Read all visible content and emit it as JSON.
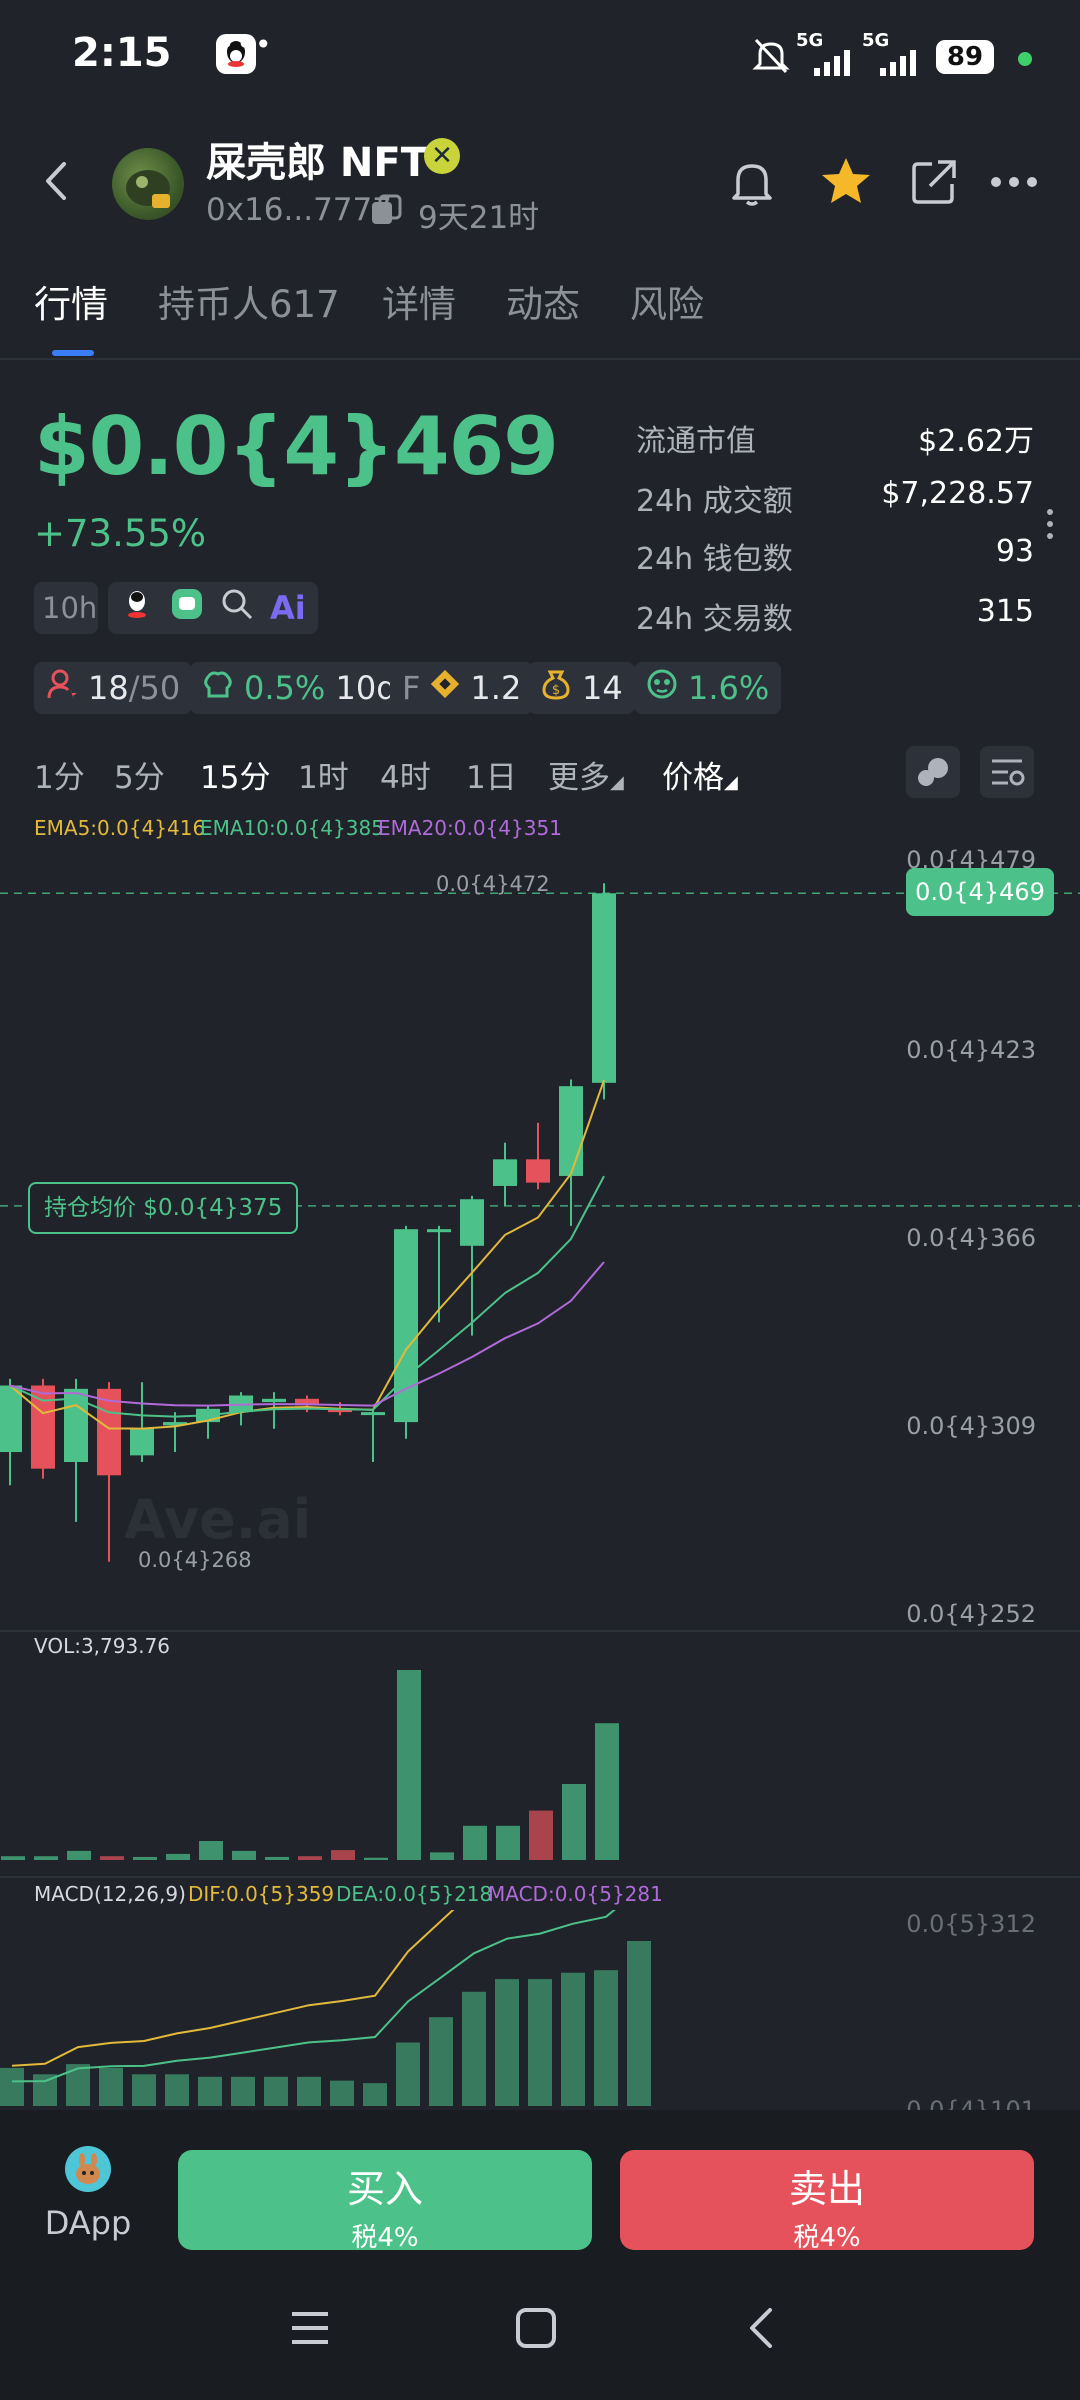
{
  "status_bar": {
    "time": "2:15",
    "dots": "•••",
    "battery": "89",
    "net1": "5G",
    "net2": "5G"
  },
  "header": {
    "token_name": "屎壳郎 NFT",
    "address": "0x16...7777",
    "age": "9天21时"
  },
  "tabs": [
    {
      "label": "行情"
    },
    {
      "label": "持币人617"
    },
    {
      "label": "详情"
    },
    {
      "label": "动态"
    },
    {
      "label": "风险"
    }
  ],
  "price": {
    "value": "$0.0{4}469",
    "change": "+73.55%"
  },
  "stats": [
    {
      "label": "流通市值",
      "value": "$2.62万"
    },
    {
      "label": "24h 成交额",
      "value": "$7,228.57"
    },
    {
      "label": "24h 钱包数",
      "value": "93"
    },
    {
      "label": "24h 交易数",
      "value": "315"
    }
  ],
  "chips1": {
    "time": "10h"
  },
  "chips2": {
    "holders": "18",
    "holders_total": "/50",
    "chef_pct": "0.5%",
    "chef_days": "10d",
    "f_label": "F",
    "f_val": "1.2",
    "bag_val": "14",
    "face_pct": "1.6%"
  },
  "intervals": {
    "items": [
      "1分",
      "5分",
      "15分",
      "1时",
      "4时",
      "1日"
    ],
    "more": "更多",
    "price": "价格",
    "active": "15分"
  },
  "ema": {
    "ema5": "EMA5:0.0{4}416",
    "ema10": "EMA10:0.0{4}385",
    "ema20": "EMA20:0.0{4}351"
  },
  "chart_data": {
    "type": "candlestick",
    "y_axis_labels": [
      "0.0{4}479",
      "0.0{4}423",
      "0.0{4}366",
      "0.0{4}309",
      "0.0{4}252"
    ],
    "current_price_label": "0.0{4}469",
    "high_label": "0.0{4}472",
    "low_label": "0.0{4}268",
    "avg_cost_label": "持仓均价 $0.0{4}375",
    "watermark": "Ave.ai",
    "candles": [
      {
        "o": 301,
        "c": 321,
        "h": 323,
        "l": 291
      },
      {
        "o": 321,
        "c": 296,
        "h": 323,
        "l": 293
      },
      {
        "o": 298,
        "c": 320,
        "h": 323,
        "l": 280
      },
      {
        "o": 320,
        "c": 294,
        "h": 322,
        "l": 268
      },
      {
        "o": 300,
        "c": 308,
        "h": 322,
        "l": 298
      },
      {
        "o": 309,
        "c": 310,
        "h": 313,
        "l": 301
      },
      {
        "o": 310,
        "c": 314,
        "h": 315,
        "l": 305
      },
      {
        "o": 313,
        "c": 318,
        "h": 319,
        "l": 309
      },
      {
        "o": 316,
        "c": 317,
        "h": 319,
        "l": 308
      },
      {
        "o": 317,
        "c": 315,
        "h": 318,
        "l": 313
      },
      {
        "o": 314,
        "c": 313,
        "h": 316,
        "l": 312
      },
      {
        "o": 313,
        "c": 313,
        "h": 314,
        "l": 298
      },
      {
        "o": 310,
        "c": 368,
        "h": 369,
        "l": 305
      },
      {
        "o": 368,
        "c": 368,
        "h": 369,
        "l": 340
      },
      {
        "o": 363,
        "c": 377,
        "h": 378,
        "l": 336
      },
      {
        "o": 381,
        "c": 389,
        "h": 394,
        "l": 375
      },
      {
        "o": 389,
        "c": 382,
        "h": 400,
        "l": 380
      },
      {
        "o": 384,
        "c": 411,
        "h": 413,
        "l": 369
      },
      {
        "o": 412,
        "c": 469,
        "h": 472,
        "l": 407
      }
    ]
  },
  "volume": {
    "label": "VOL:3,793.76",
    "bars": [
      {
        "v": 0.5,
        "up": true
      },
      {
        "v": 0.5,
        "up": true
      },
      {
        "v": 1.2,
        "up": true
      },
      {
        "v": 0.5,
        "up": false
      },
      {
        "v": 0.4,
        "up": true
      },
      {
        "v": 0.8,
        "up": true
      },
      {
        "v": 2.5,
        "up": true
      },
      {
        "v": 1.2,
        "up": true
      },
      {
        "v": 0.4,
        "up": true
      },
      {
        "v": 0.5,
        "up": false
      },
      {
        "v": 1.3,
        "up": false
      },
      {
        "v": 0.3,
        "up": true
      },
      {
        "v": 25,
        "up": true
      },
      {
        "v": 1,
        "up": true
      },
      {
        "v": 4.5,
        "up": true
      },
      {
        "v": 4.5,
        "up": true
      },
      {
        "v": 6.5,
        "up": false
      },
      {
        "v": 10,
        "up": true
      },
      {
        "v": 18,
        "up": true
      }
    ]
  },
  "macd": {
    "label": "MACD(12,26,9)",
    "dif": "DIF:0.0{5}359",
    "dea": "DEA:0.0{5}218",
    "macd": "MACD:0.0{5}281",
    "axis_top": "0.0{5}312",
    "axis_bottom": "0.0{4}101",
    "bars": [
      3,
      2.5,
      3.3,
      3,
      2.5,
      2.5,
      2.3,
      2.3,
      2.3,
      2.3,
      2,
      1.8,
      5,
      7,
      9,
      10,
      10,
      10.5,
      10.7,
      13
    ]
  },
  "bottom": {
    "dapp": "DApp",
    "buy": "买入",
    "buy_tax": "税4%",
    "sell": "卖出",
    "sell_tax": "税4%"
  },
  "colors": {
    "up": "#4cc28a",
    "down": "#e5525b",
    "ema5": "#e2b93b",
    "ema10": "#4cc28a",
    "ema20": "#b06ad9"
  }
}
